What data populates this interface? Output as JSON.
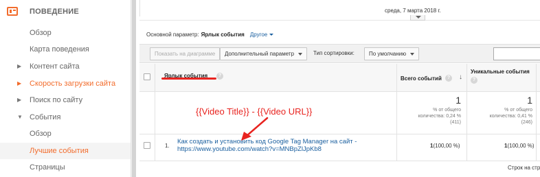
{
  "sidebar": {
    "section_title": "ПОВЕДЕНИЕ",
    "items": [
      {
        "label": "Обзор"
      },
      {
        "label": "Карта поведения"
      },
      {
        "label": "Контент сайта"
      },
      {
        "label": "Скорость загрузки сайта"
      },
      {
        "label": "Поиск по сайту"
      },
      {
        "label": "События"
      },
      {
        "label": "Обзор"
      },
      {
        "label": "Лучшие события"
      },
      {
        "label": "Страницы"
      }
    ]
  },
  "timeline": {
    "date_label": "среда, 7 марта 2018 г."
  },
  "dimension": {
    "label": "Основной параметр:",
    "value": "Ярлык события",
    "other": "Другое"
  },
  "toolbar": {
    "plot_button": "Показать на диаграмме",
    "secondary_dimension": "Дополнительный параметр",
    "sort_label": "Тип сортировки:",
    "sort_value": "По умолчанию"
  },
  "table": {
    "columns": {
      "label_col": "Ярлык события",
      "total_events": "Всего событий",
      "unique_events": "Уникальные события"
    },
    "totals": {
      "total_events": "1",
      "total_events_sub": "% от общего\nколичества: 0,24 %\n(411)",
      "unique_events": "1",
      "unique_events_sub": "% от общего\nколичества: 0,41 %\n(246)"
    },
    "rows": [
      {
        "index": "1.",
        "label": "Как создать и установить код Google Tag Manager на сайт - https://www.youtube.com/watch?v=MNBpZlJpKb8",
        "total_events": "1",
        "total_events_pct": "(100,00 %)",
        "unique_events": "1",
        "unique_events_pct": "(100,00 %)"
      }
    ]
  },
  "annotation": {
    "text": "{{Video Title}} - {{Video URL}}"
  },
  "footer": {
    "rows_per_page": "Строк на стр"
  },
  "colors": {
    "accent": "#f26c2c",
    "annotation": "#e8231f",
    "link": "#1a5f9f"
  }
}
